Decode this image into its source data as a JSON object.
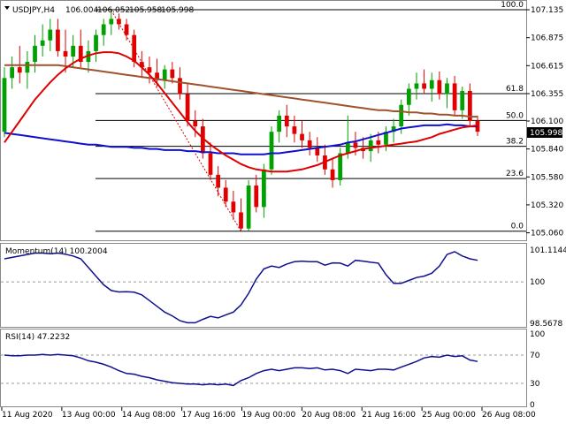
{
  "header": {
    "symbol": "USDJPY,H4",
    "open": "106.004",
    "high": "106.052",
    "low": "105.958",
    "close": "105.998"
  },
  "momentum_label": "Momentum(14) 100.2004",
  "rsi_label": "RSI(14) 47.2232",
  "current_price_badge": "105.998",
  "colors": {
    "bull": "#00a000",
    "bear": "#e00000",
    "sma_red": "#e00000",
    "sma_blue": "#1010d0",
    "sma_brown": "#a0522d",
    "indicator_line": "#10108f",
    "fib_line": "#000000"
  },
  "fib_levels": [
    {
      "label": "100.0",
      "price": 107.135
    },
    {
      "label": "61.8",
      "price": 106.355
    },
    {
      "label": "50.0",
      "price": 106.105
    },
    {
      "label": "38.2",
      "price": 105.865
    },
    {
      "label": "23.6",
      "price": 105.565
    },
    {
      "label": "0.0",
      "price": 105.075
    }
  ],
  "chart_data": [
    {
      "type": "candlestick",
      "title": "",
      "ylim": [
        105.04,
        107.16
      ],
      "yticks": [
        "107.135",
        "106.875",
        "106.615",
        "106.355",
        "106.100",
        "105.840",
        "105.580",
        "105.320",
        "105.060"
      ],
      "xticks": [
        "11 Aug 2020",
        "13 Aug 00:00",
        "14 Aug 08:00",
        "17 Aug 16:00",
        "19 Aug 00:00",
        "20 Aug 08:00",
        "21 Aug 16:00",
        "25 Aug 00:00",
        "26 Aug 08:00"
      ],
      "candles": [
        {
          "o": 106.0,
          "h": 106.6,
          "l": 105.95,
          "c": 106.5
        },
        {
          "o": 106.5,
          "h": 106.7,
          "l": 106.4,
          "c": 106.6
        },
        {
          "o": 106.6,
          "h": 106.8,
          "l": 106.45,
          "c": 106.55
        },
        {
          "o": 106.55,
          "h": 106.75,
          "l": 106.4,
          "c": 106.65
        },
        {
          "o": 106.65,
          "h": 106.9,
          "l": 106.55,
          "c": 106.8
        },
        {
          "o": 106.8,
          "h": 107.0,
          "l": 106.7,
          "c": 106.85
        },
        {
          "o": 106.85,
          "h": 107.05,
          "l": 106.75,
          "c": 106.95
        },
        {
          "o": 106.95,
          "h": 107.05,
          "l": 106.7,
          "c": 106.75
        },
        {
          "o": 106.75,
          "h": 106.95,
          "l": 106.55,
          "c": 106.7
        },
        {
          "o": 106.7,
          "h": 106.9,
          "l": 106.6,
          "c": 106.8
        },
        {
          "o": 106.8,
          "h": 106.95,
          "l": 106.6,
          "c": 106.65
        },
        {
          "o": 106.65,
          "h": 106.85,
          "l": 106.55,
          "c": 106.75
        },
        {
          "o": 106.75,
          "h": 106.95,
          "l": 106.65,
          "c": 106.9
        },
        {
          "o": 106.9,
          "h": 107.05,
          "l": 106.8,
          "c": 107.0
        },
        {
          "o": 107.0,
          "h": 107.13,
          "l": 106.9,
          "c": 107.05
        },
        {
          "o": 107.05,
          "h": 107.1,
          "l": 106.95,
          "c": 107.0
        },
        {
          "o": 107.0,
          "h": 107.05,
          "l": 106.85,
          "c": 106.9
        },
        {
          "o": 106.9,
          "h": 106.95,
          "l": 106.6,
          "c": 106.65
        },
        {
          "o": 106.65,
          "h": 106.75,
          "l": 106.5,
          "c": 106.6
        },
        {
          "o": 106.6,
          "h": 106.7,
          "l": 106.45,
          "c": 106.55
        },
        {
          "o": 106.55,
          "h": 106.68,
          "l": 106.42,
          "c": 106.48
        },
        {
          "o": 106.48,
          "h": 106.62,
          "l": 106.4,
          "c": 106.58
        },
        {
          "o": 106.58,
          "h": 106.65,
          "l": 106.45,
          "c": 106.5
        },
        {
          "o": 106.5,
          "h": 106.6,
          "l": 106.3,
          "c": 106.35
        },
        {
          "o": 106.35,
          "h": 106.45,
          "l": 106.05,
          "c": 106.1
        },
        {
          "o": 106.1,
          "h": 106.2,
          "l": 105.95,
          "c": 106.05
        },
        {
          "o": 106.05,
          "h": 106.12,
          "l": 105.75,
          "c": 105.8
        },
        {
          "o": 105.8,
          "h": 105.9,
          "l": 105.55,
          "c": 105.6
        },
        {
          "o": 105.6,
          "h": 105.68,
          "l": 105.4,
          "c": 105.48
        },
        {
          "o": 105.48,
          "h": 105.55,
          "l": 105.3,
          "c": 105.35
        },
        {
          "o": 105.35,
          "h": 105.45,
          "l": 105.18,
          "c": 105.25
        },
        {
          "o": 105.25,
          "h": 105.38,
          "l": 105.07,
          "c": 105.1
        },
        {
          "o": 105.1,
          "h": 105.55,
          "l": 105.08,
          "c": 105.5
        },
        {
          "o": 105.5,
          "h": 105.6,
          "l": 105.25,
          "c": 105.3
        },
        {
          "o": 105.3,
          "h": 105.7,
          "l": 105.2,
          "c": 105.65
        },
        {
          "o": 105.65,
          "h": 106.05,
          "l": 105.6,
          "c": 106.0
        },
        {
          "o": 106.0,
          "h": 106.2,
          "l": 105.9,
          "c": 106.15
        },
        {
          "o": 106.15,
          "h": 106.25,
          "l": 105.95,
          "c": 106.05
        },
        {
          "o": 106.05,
          "h": 106.15,
          "l": 105.9,
          "c": 105.98
        },
        {
          "o": 105.98,
          "h": 106.1,
          "l": 105.85,
          "c": 105.92
        },
        {
          "o": 105.92,
          "h": 106.0,
          "l": 105.78,
          "c": 105.85
        },
        {
          "o": 105.85,
          "h": 105.95,
          "l": 105.72,
          "c": 105.78
        },
        {
          "o": 105.78,
          "h": 105.88,
          "l": 105.6,
          "c": 105.65
        },
        {
          "o": 105.65,
          "h": 105.75,
          "l": 105.48,
          "c": 105.55
        },
        {
          "o": 105.55,
          "h": 105.85,
          "l": 105.5,
          "c": 105.8
        },
        {
          "o": 105.8,
          "h": 106.15,
          "l": 105.75,
          "c": 105.9
        },
        {
          "o": 105.9,
          "h": 106.0,
          "l": 105.78,
          "c": 105.85
        },
        {
          "o": 105.85,
          "h": 105.95,
          "l": 105.75,
          "c": 105.82
        },
        {
          "o": 105.82,
          "h": 105.98,
          "l": 105.72,
          "c": 105.92
        },
        {
          "o": 105.92,
          "h": 106.0,
          "l": 105.8,
          "c": 105.88
        },
        {
          "o": 105.88,
          "h": 106.05,
          "l": 105.82,
          "c": 106.0
        },
        {
          "o": 106.0,
          "h": 106.12,
          "l": 105.9,
          "c": 106.05
        },
        {
          "o": 106.05,
          "h": 106.3,
          "l": 105.98,
          "c": 106.25
        },
        {
          "o": 106.25,
          "h": 106.45,
          "l": 106.15,
          "c": 106.4
        },
        {
          "o": 106.4,
          "h": 106.55,
          "l": 106.3,
          "c": 106.45
        },
        {
          "o": 106.45,
          "h": 106.58,
          "l": 106.35,
          "c": 106.4
        },
        {
          "o": 106.4,
          "h": 106.55,
          "l": 106.28,
          "c": 106.48
        },
        {
          "o": 106.48,
          "h": 106.56,
          "l": 106.3,
          "c": 106.35
        },
        {
          "o": 106.35,
          "h": 106.5,
          "l": 106.22,
          "c": 106.45
        },
        {
          "o": 106.45,
          "h": 106.52,
          "l": 106.15,
          "c": 106.2
        },
        {
          "o": 106.2,
          "h": 106.42,
          "l": 106.12,
          "c": 106.38
        },
        {
          "o": 106.38,
          "h": 106.45,
          "l": 106.05,
          "c": 106.1
        },
        {
          "o": 106.1,
          "h": 106.15,
          "l": 105.96,
          "c": 106.0
        }
      ],
      "series": [
        {
          "color_key": "sma_brown",
          "values": [
            106.62,
            106.62,
            106.62,
            106.62,
            106.62,
            106.62,
            106.62,
            106.62,
            106.61,
            106.6,
            106.59,
            106.58,
            106.57,
            106.56,
            106.55,
            106.54,
            106.53,
            106.52,
            106.51,
            106.5,
            106.49,
            106.48,
            106.47,
            106.46,
            106.45,
            106.44,
            106.43,
            106.42,
            106.41,
            106.4,
            106.39,
            106.38,
            106.37,
            106.36,
            106.35,
            106.34,
            106.33,
            106.32,
            106.31,
            106.3,
            106.29,
            106.28,
            106.27,
            106.26,
            106.25,
            106.24,
            106.23,
            106.22,
            106.21,
            106.2,
            106.2,
            106.19,
            106.19,
            106.18,
            106.18,
            106.17,
            106.17,
            106.16,
            106.16,
            106.15,
            106.15,
            106.14,
            106.14
          ]
        },
        {
          "color_key": "sma_blue",
          "values": [
            105.99,
            105.98,
            105.97,
            105.96,
            105.95,
            105.94,
            105.93,
            105.92,
            105.91,
            105.9,
            105.89,
            105.88,
            105.88,
            105.87,
            105.86,
            105.86,
            105.86,
            105.85,
            105.85,
            105.84,
            105.84,
            105.83,
            105.83,
            105.83,
            105.82,
            105.82,
            105.81,
            105.81,
            105.8,
            105.8,
            105.8,
            105.79,
            105.79,
            105.79,
            105.79,
            105.8,
            105.8,
            105.81,
            105.82,
            105.83,
            105.84,
            105.85,
            105.86,
            105.87,
            105.88,
            105.9,
            105.91,
            105.93,
            105.95,
            105.97,
            105.99,
            106.01,
            106.03,
            106.04,
            106.05,
            106.06,
            106.06,
            106.06,
            106.07,
            106.06,
            106.06,
            106.05,
            106.05
          ]
        },
        {
          "color_key": "sma_red",
          "values": [
            105.9,
            106.0,
            106.1,
            106.2,
            106.3,
            106.38,
            106.46,
            106.53,
            106.59,
            106.64,
            106.68,
            106.71,
            106.73,
            106.74,
            106.74,
            106.73,
            106.7,
            106.66,
            106.6,
            106.53,
            106.45,
            106.36,
            106.27,
            106.18,
            106.09,
            106.01,
            105.94,
            105.88,
            105.83,
            105.78,
            105.74,
            105.7,
            105.67,
            105.65,
            105.64,
            105.63,
            105.63,
            105.63,
            105.64,
            105.65,
            105.67,
            105.69,
            105.72,
            105.75,
            105.78,
            105.8,
            105.82,
            105.84,
            105.85,
            105.86,
            105.87,
            105.88,
            105.89,
            105.9,
            105.91,
            105.93,
            105.95,
            105.98,
            106.0,
            106.02,
            106.04,
            106.05,
            106.06
          ]
        }
      ]
    },
    {
      "type": "line",
      "title": "Momentum(14) 100.2004",
      "ylim": [
        98.5,
        101.2
      ],
      "yticks": [
        "101.1144",
        "100",
        "98.5678"
      ],
      "series": [
        {
          "color_key": "indicator_line",
          "values": [
            100.8,
            100.85,
            100.9,
            100.95,
            101.0,
            101.0,
            100.98,
            101.0,
            100.96,
            100.9,
            100.8,
            100.5,
            100.2,
            99.9,
            99.7,
            99.65,
            99.66,
            99.64,
            99.55,
            99.35,
            99.15,
            98.95,
            98.82,
            98.65,
            98.58,
            98.58,
            98.7,
            98.8,
            98.75,
            98.85,
            98.95,
            99.2,
            99.6,
            100.1,
            100.45,
            100.55,
            100.5,
            100.62,
            100.7,
            100.72,
            100.7,
            100.7,
            100.58,
            100.66,
            100.65,
            100.55,
            100.75,
            100.72,
            100.68,
            100.65,
            100.25,
            99.95,
            99.95,
            100.05,
            100.15,
            100.2,
            100.3,
            100.55,
            100.95,
            101.05,
            100.9,
            100.8,
            100.75
          ]
        }
      ]
    },
    {
      "type": "line",
      "title": "RSI(14) 47.2232",
      "ylim": [
        0,
        100
      ],
      "yticks": [
        "100",
        "70",
        "30",
        "0"
      ],
      "series": [
        {
          "color_key": "indicator_line",
          "values": [
            70,
            69,
            69,
            70,
            70,
            71,
            70,
            71,
            70,
            69,
            66,
            62,
            60,
            57,
            53,
            48,
            44,
            43,
            40,
            38,
            35,
            33,
            31,
            30,
            29,
            29,
            28,
            29,
            28,
            29,
            27,
            34,
            38,
            44,
            48,
            50,
            48,
            50,
            52,
            52,
            51,
            52,
            49,
            50,
            48,
            44,
            50,
            49,
            48,
            50,
            50,
            49,
            53,
            57,
            61,
            66,
            68,
            67,
            70,
            68,
            69,
            63,
            61
          ]
        }
      ]
    }
  ]
}
